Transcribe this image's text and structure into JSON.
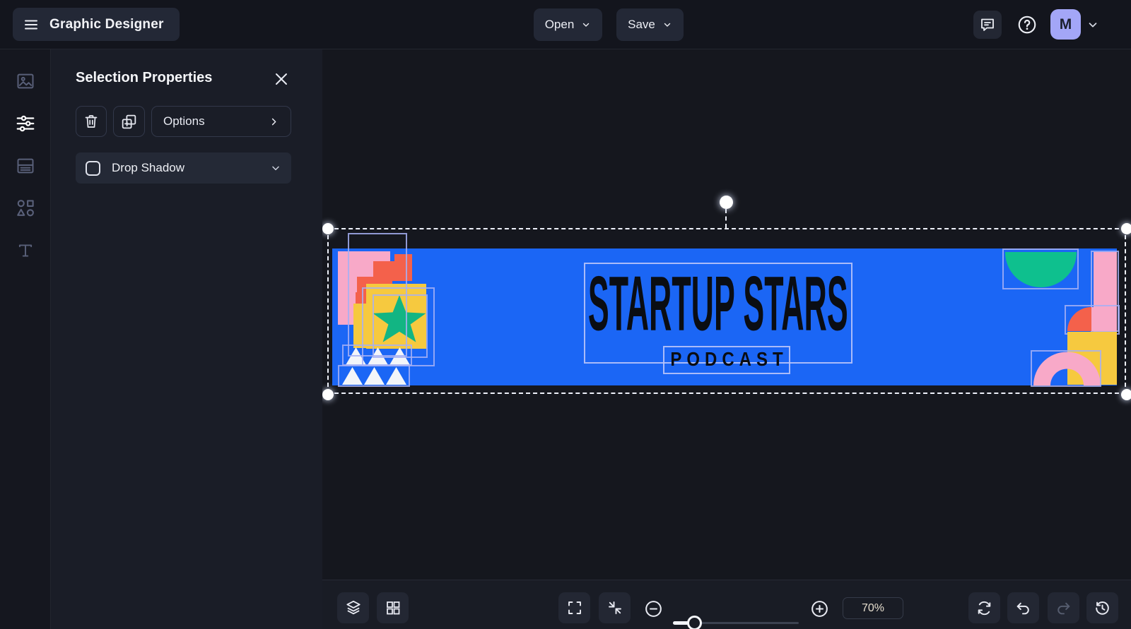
{
  "topbar": {
    "app_title": "Graphic Designer",
    "open_label": "Open",
    "save_label": "Save",
    "avatar_initial": "M"
  },
  "tool_rail": {
    "active_item": "selection-properties",
    "items": [
      {
        "id": "images",
        "icon": "image-icon"
      },
      {
        "id": "selection-properties",
        "icon": "sliders-icon"
      },
      {
        "id": "pages",
        "icon": "page-layout-icon"
      },
      {
        "id": "shapes",
        "icon": "shapes-icon"
      },
      {
        "id": "text",
        "icon": "text-icon"
      }
    ]
  },
  "panel": {
    "title": "Selection Properties",
    "options_label": "Options",
    "drop_shadow": {
      "label": "Drop Shadow",
      "checked": false
    }
  },
  "canvas": {
    "selected": true,
    "banner": {
      "title": "STARTUP STARS",
      "subtitle": "PODCAST",
      "background_color": "#1B66F5"
    }
  },
  "toolbar": {
    "zoom_percent": "70%"
  },
  "colors": {
    "banner_blue": "#1B66F5",
    "shape_pink": "#F8A9C8",
    "shape_orange": "#F4614B",
    "shape_yellow": "#F6C93F",
    "star_green": "#12B583",
    "semicircle_green": "#0EC08E",
    "group_outline": "#A6B0F5",
    "avatar_bg": "#A3A6F7",
    "selection_dash": "#EEF1FA"
  },
  "icons": {
    "topbar": [
      "menu-icon",
      "chevron-down-icon",
      "comment-icon",
      "help-icon"
    ],
    "rail": [
      "image-icon",
      "sliders-icon",
      "page-layout-icon",
      "shapes-icon",
      "text-icon"
    ],
    "panel": [
      "close-icon",
      "trash-icon",
      "duplicate-icon",
      "chevron-right-icon",
      "chevron-down-icon"
    ],
    "toolbar": [
      "layers-icon",
      "grid-icon",
      "fullscreen-icon",
      "fit-screen-icon",
      "zoom-out-icon",
      "zoom-in-icon",
      "reset-icon",
      "undo-icon",
      "redo-icon",
      "history-icon"
    ]
  }
}
